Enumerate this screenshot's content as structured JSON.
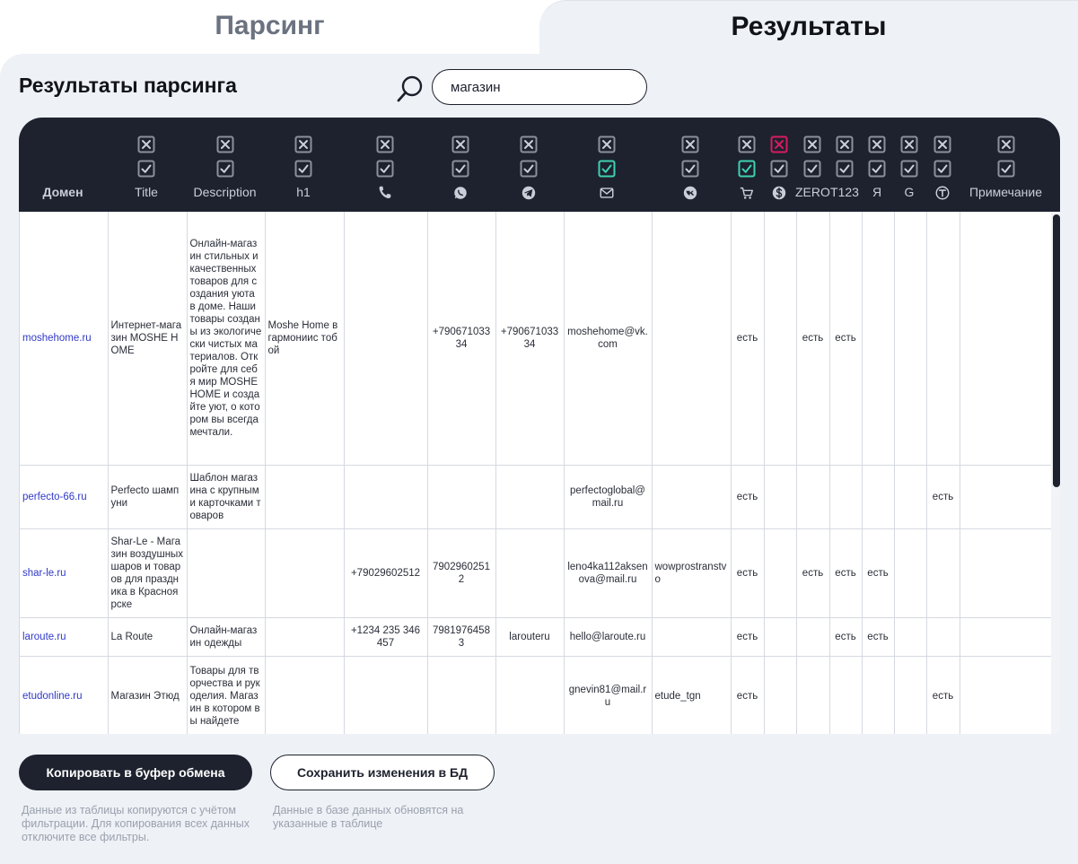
{
  "tabs": {
    "parsing": "Парсинг",
    "results": "Результаты"
  },
  "page_title": "Результаты парсинга",
  "search": {
    "value": "магазин",
    "icon": "search-icon"
  },
  "colors": {
    "dark": "#1d222e",
    "accent_green": "#3fd1b0",
    "accent_red": "#d81b60",
    "link": "#2f39c7",
    "panel": "#eef1f6"
  },
  "columns": [
    {
      "key": "domain",
      "label": "Домен",
      "bold": true,
      "icon": "",
      "checks": ""
    },
    {
      "key": "title",
      "label": "Title",
      "icon": "",
      "checks": "xv"
    },
    {
      "key": "description",
      "label": "Description",
      "icon": "",
      "checks": "xv"
    },
    {
      "key": "h1",
      "label": "h1",
      "icon": "",
      "checks": "xv"
    },
    {
      "key": "phone",
      "label": "",
      "icon": "phone-icon",
      "checks": "xv"
    },
    {
      "key": "whatsapp",
      "label": "",
      "icon": "whatsapp-icon",
      "checks": "xv"
    },
    {
      "key": "telegram",
      "label": "",
      "icon": "telegram-icon",
      "checks": "xv"
    },
    {
      "key": "email",
      "label": "",
      "icon": "mail-icon",
      "checks": "xV"
    },
    {
      "key": "vk",
      "label": "",
      "icon": "vk-icon",
      "checks": "xv"
    },
    {
      "key": "cart",
      "label": "",
      "icon": "cart-icon",
      "checks": "xV"
    },
    {
      "key": "pay",
      "label": "",
      "icon": "dollar-icon",
      "checks": "Xv"
    },
    {
      "key": "zero",
      "label": "ZERO",
      "icon": "",
      "checks": "xv"
    },
    {
      "key": "t123",
      "label": "T123",
      "icon": "",
      "checks": "xv"
    },
    {
      "key": "ya",
      "label": "Я",
      "icon": "",
      "checks": "xv"
    },
    {
      "key": "g",
      "label": "G",
      "icon": "",
      "checks": "xv"
    },
    {
      "key": "t",
      "label": "",
      "icon": "t-circle-icon",
      "checks": "xv"
    },
    {
      "key": "note",
      "label": "Примечание",
      "icon": "",
      "checks": "xv"
    }
  ],
  "rows": [
    [
      "moshehome.ru",
      "Интернет-магазин MOSHE HOME",
      "Онлайн-магазин стильных и качественных товаров для создания уюта в доме. Наши товары созданы из экологически чистых материалов. Откройте для себя мир MOSHE HOME и создайте уют, о котором вы всегда мечтали.",
      "Moshe Home в гармониис тобой",
      "",
      "+79067103334",
      "+79067103334",
      "moshehome@vk.com",
      "",
      "есть",
      "",
      "есть",
      "есть",
      "",
      "",
      "",
      ""
    ],
    [
      "perfecto-66.ru",
      "Perfecto шампуни",
      "Шаблон магазина с крупными карточками товаров",
      "",
      "",
      "",
      "",
      "perfectoglobal@mail.ru",
      "",
      "есть",
      "",
      "",
      "",
      "",
      "",
      "есть",
      ""
    ],
    [
      "shar-le.ru",
      "Shar-Le - Магазин воздушных шаров и товаров для праздника в Красноярске",
      "",
      "",
      "+79029602512",
      "79029602512",
      "",
      "leno4ka112aksenova@mail.ru",
      "wowprostranstvo",
      "есть",
      "",
      "есть",
      "есть",
      "есть",
      "",
      "",
      ""
    ],
    [
      "laroute.ru",
      "La Route",
      "Онлайн-магазин одежды",
      "",
      "+1234 235 346 457",
      "79819764583",
      "larouteru",
      "hello@laroute.ru",
      "",
      "есть",
      "",
      "",
      "есть",
      "есть",
      "",
      "",
      ""
    ],
    [
      "etudonline.ru",
      "Магазин Этюд",
      "Товары для творчества и рукоделия. Магазин в котором вы найдете",
      "",
      "",
      "",
      "",
      "gnevin81@mail.ru",
      "etude_tgn",
      "есть",
      "",
      "",
      "",
      "",
      "",
      "есть",
      ""
    ]
  ],
  "buttons": {
    "copy": "Копировать в буфер обмена",
    "save": "Сохранить изменения в БД"
  },
  "notes": {
    "copy": "Данные из таблицы копируются с учётом фильтрации. Для копирования всех данных отключите все фильтры.",
    "save": "Данные в базе данных обновятся на указанные в таблице"
  }
}
